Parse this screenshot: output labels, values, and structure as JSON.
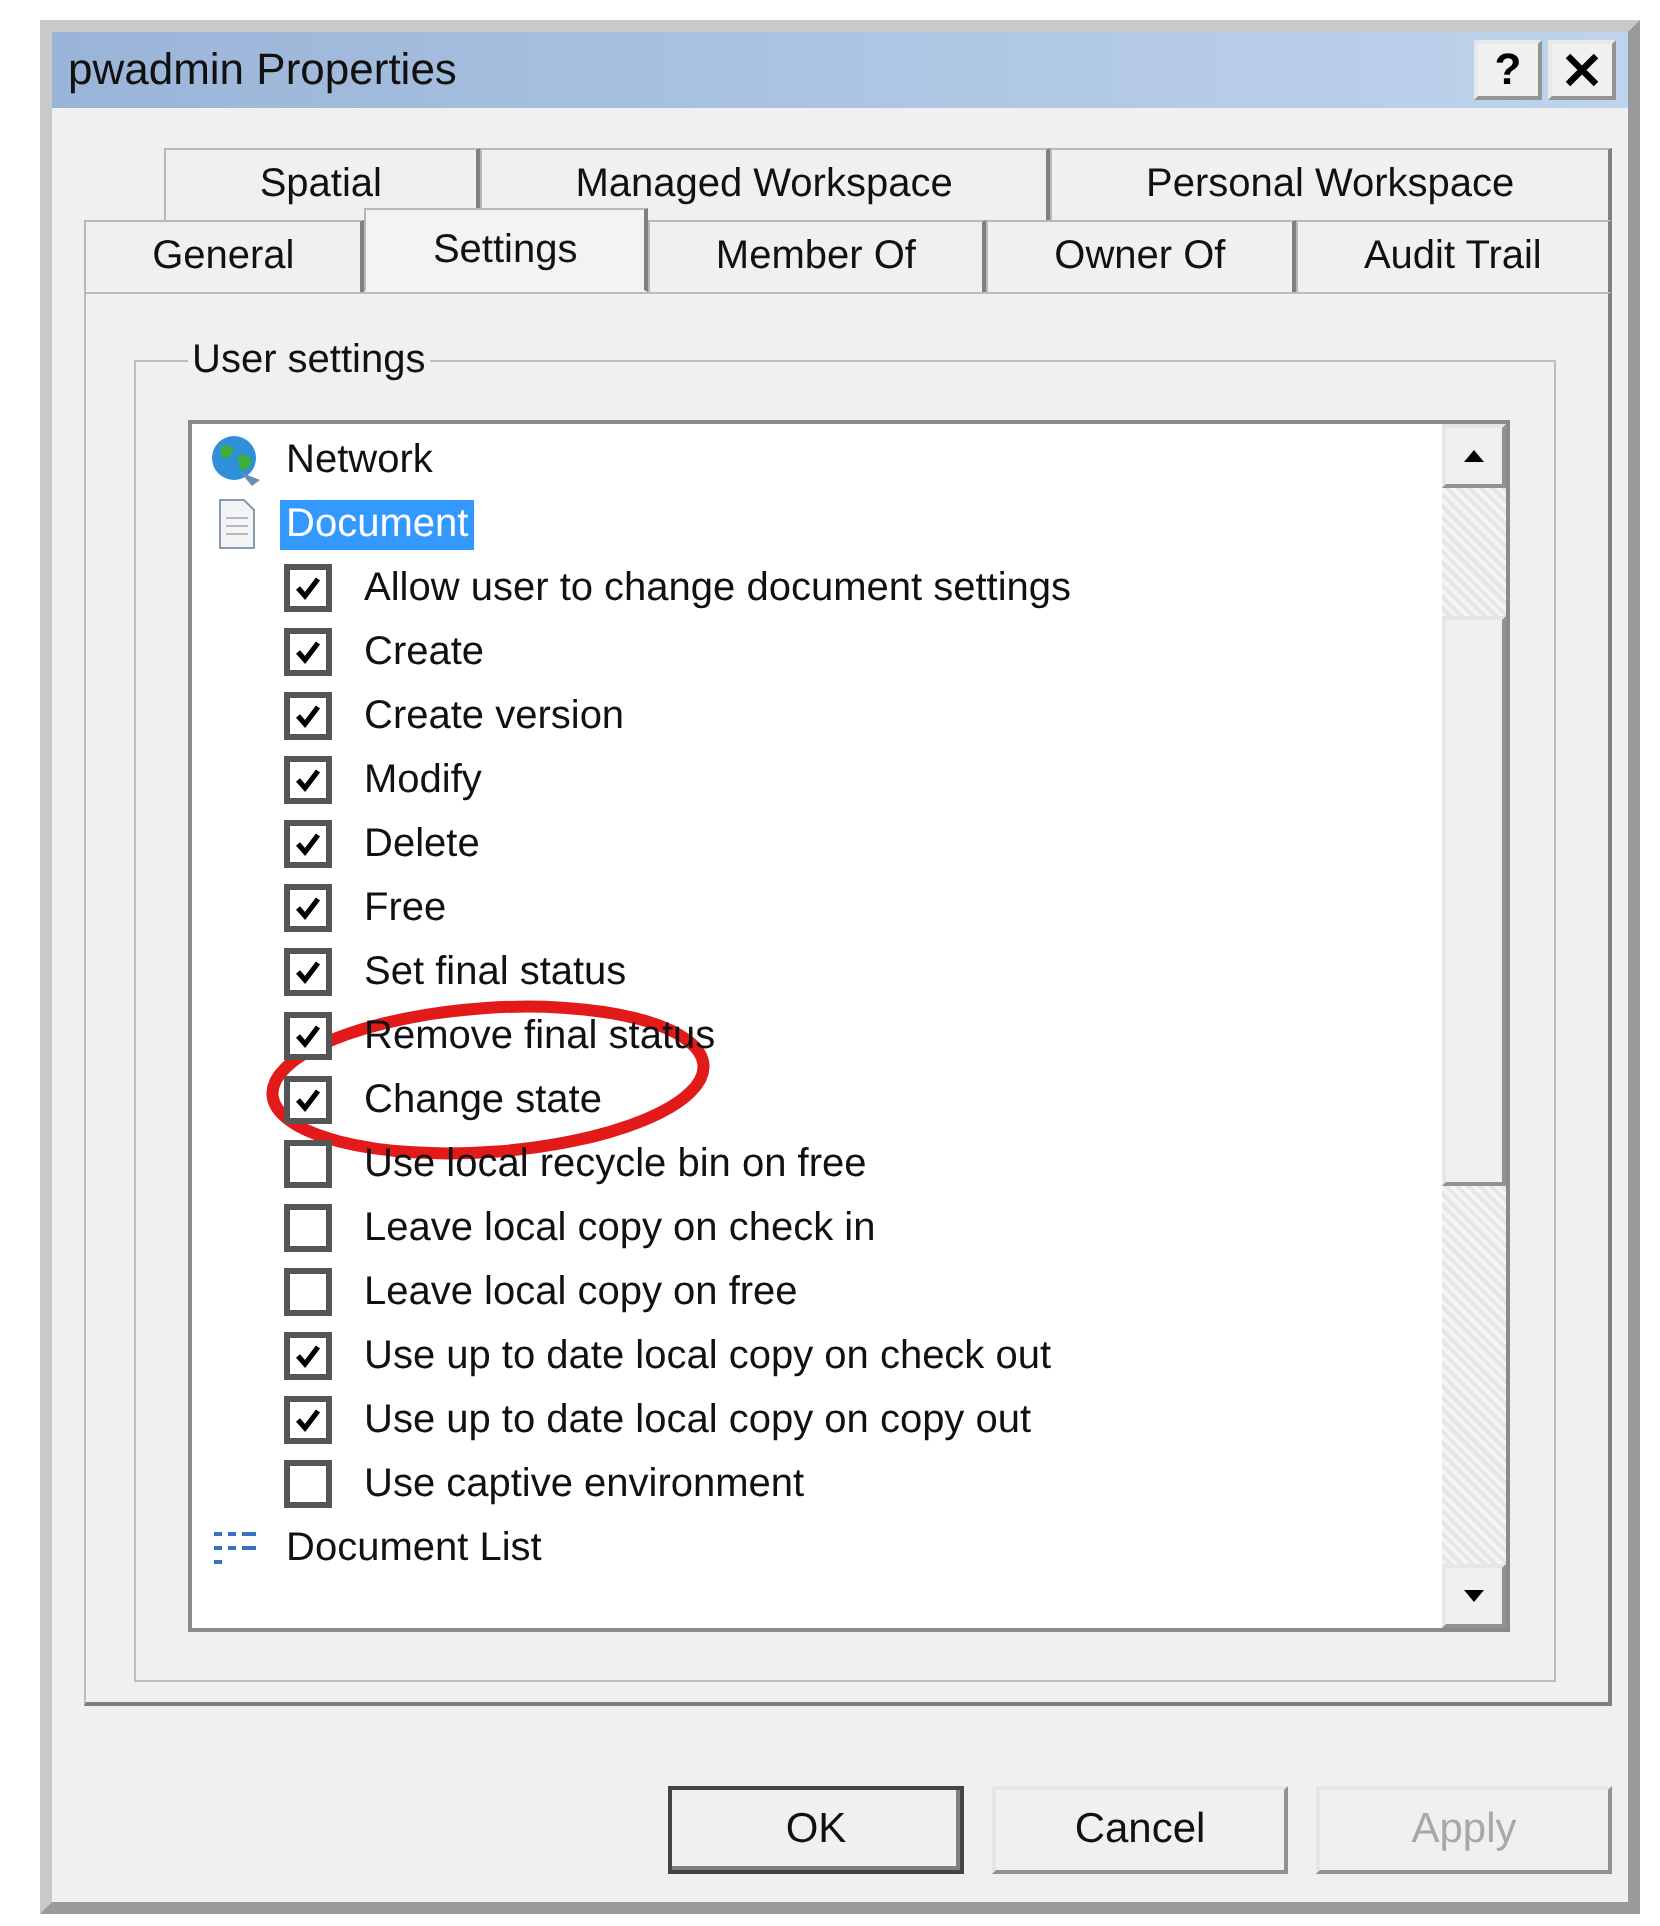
{
  "window": {
    "title": "pwadmin Properties",
    "help": "?"
  },
  "tab_rows": [
    [
      {
        "label": "Spatial",
        "selected": false
      },
      {
        "label": "Managed Workspace",
        "selected": false
      },
      {
        "label": "Personal Workspace",
        "selected": false
      }
    ],
    [
      {
        "label": "General",
        "selected": false
      },
      {
        "label": "Settings",
        "selected": true
      },
      {
        "label": "Member Of",
        "selected": false
      },
      {
        "label": "Owner Of",
        "selected": false
      },
      {
        "label": "Audit Trail",
        "selected": false
      }
    ]
  ],
  "group": {
    "label": "User settings"
  },
  "tree": [
    {
      "kind": "globe",
      "label": "Network",
      "selected": false
    },
    {
      "kind": "document",
      "label": "Document",
      "selected": true,
      "children": [
        {
          "kind": "checkbox",
          "label": "Allow user to change document settings",
          "checked": true
        },
        {
          "kind": "checkbox",
          "label": "Create",
          "checked": true
        },
        {
          "kind": "checkbox",
          "label": "Create version",
          "checked": true
        },
        {
          "kind": "checkbox",
          "label": "Modify",
          "checked": true
        },
        {
          "kind": "checkbox",
          "label": "Delete",
          "checked": true
        },
        {
          "kind": "checkbox",
          "label": "Free",
          "checked": true
        },
        {
          "kind": "checkbox",
          "label": "Set final status",
          "checked": true
        },
        {
          "kind": "checkbox",
          "label": "Remove final status",
          "checked": true
        },
        {
          "kind": "checkbox",
          "label": "Change state",
          "checked": true
        },
        {
          "kind": "checkbox",
          "label": "Use local recycle bin on free",
          "checked": false
        },
        {
          "kind": "checkbox",
          "label": "Leave local copy on check in",
          "checked": false
        },
        {
          "kind": "checkbox",
          "label": "Leave local copy on free",
          "checked": false
        },
        {
          "kind": "checkbox",
          "label": "Use up to date local copy on check out",
          "checked": true
        },
        {
          "kind": "checkbox",
          "label": "Use up to date local copy on copy out",
          "checked": true
        },
        {
          "kind": "checkbox",
          "label": "Use captive environment",
          "checked": false
        }
      ]
    },
    {
      "kind": "list",
      "label": "Document List",
      "selected": false
    }
  ],
  "buttons": [
    {
      "label": "OK",
      "default": true,
      "disabled": false
    },
    {
      "label": "Cancel",
      "default": false,
      "disabled": false
    },
    {
      "label": "Apply",
      "default": false,
      "disabled": true
    }
  ]
}
